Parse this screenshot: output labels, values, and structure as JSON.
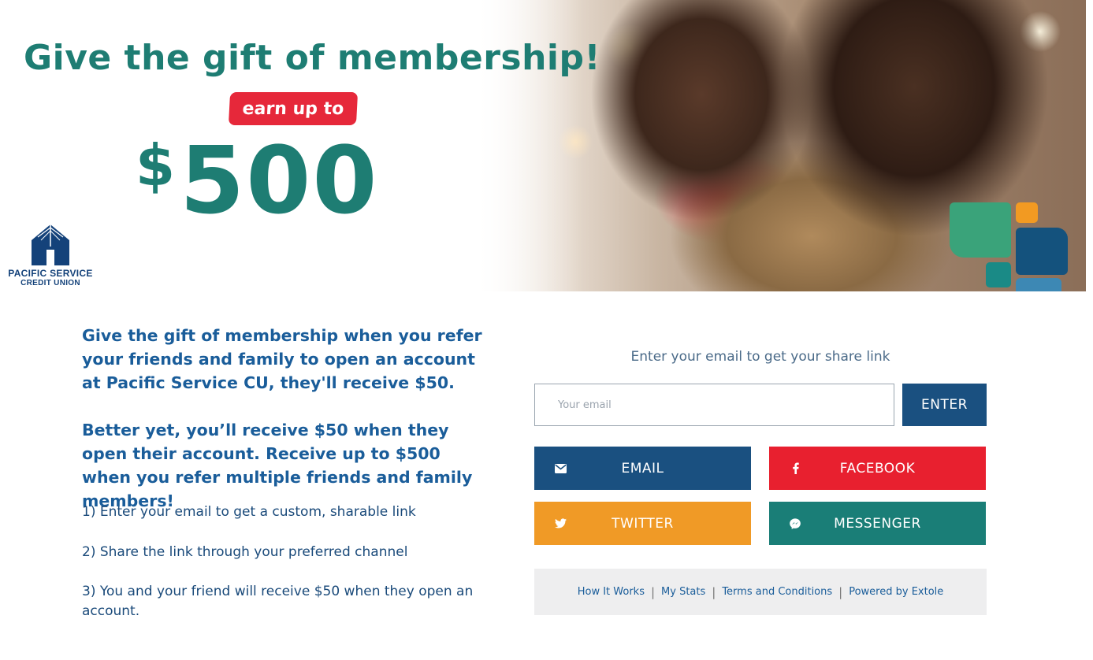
{
  "hero": {
    "title": "Give the gift of membership!",
    "earn_label": "earn up to",
    "dollar_sign": "$",
    "amount": "500",
    "logo_line1": "PACIFIC SERVICE",
    "logo_line2": "CREDIT UNION"
  },
  "intro": {
    "paragraph1": "Give the gift of membership when you refer your friends and family to open an account at Pacific Service CU, they'll receive $50.",
    "paragraph2": "Better yet, you’ll receive $50 when they open their account. Receive up to $500 when you refer multiple friends and family members!",
    "steps": [
      "1) Enter your email to get a custom, sharable link",
      "2) Share the link through your preferred channel",
      "3) You and your friend will receive $50 when they open an account."
    ]
  },
  "share_panel": {
    "prompt": "Enter your email to get your share link",
    "email_placeholder": "Your email",
    "email_value": "",
    "enter_label": "ENTER",
    "buttons": {
      "email": "EMAIL",
      "facebook": "FACEBOOK",
      "twitter": "TWITTER",
      "messenger": "MESSENGER"
    },
    "footer_links": {
      "how_it_works": "How It Works",
      "my_stats": "My Stats",
      "terms": "Terms and Conditions",
      "powered_by": "Powered by Extole"
    }
  },
  "colors": {
    "teal": "#1e7d73",
    "red": "#e8202f",
    "navy": "#1a5080",
    "orange": "#f09a26",
    "messenger_teal": "#1a7e77",
    "text_blue": "#1a5d9a"
  },
  "icons": {
    "email": "envelope-icon",
    "facebook": "facebook-icon",
    "twitter": "twitter-icon",
    "messenger": "messenger-icon"
  }
}
